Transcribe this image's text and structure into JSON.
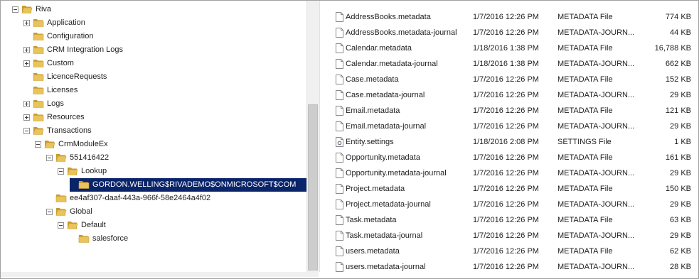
{
  "tree": [
    {
      "label": "Riva",
      "expander": "minus",
      "depth": 0,
      "open": true
    },
    {
      "label": "Application",
      "expander": "plus",
      "depth": 1
    },
    {
      "label": "Configuration",
      "expander": "none",
      "depth": 1
    },
    {
      "label": "CRM Integration Logs",
      "expander": "plus",
      "depth": 1
    },
    {
      "label": "Custom",
      "expander": "plus",
      "depth": 1
    },
    {
      "label": "LicenceRequests",
      "expander": "none",
      "depth": 1
    },
    {
      "label": "Licenses",
      "expander": "none",
      "depth": 1
    },
    {
      "label": "Logs",
      "expander": "plus",
      "depth": 1
    },
    {
      "label": "Resources",
      "expander": "plus",
      "depth": 1
    },
    {
      "label": "Transactions",
      "expander": "minus",
      "depth": 1,
      "open": true
    },
    {
      "label": "CrmModuleEx",
      "expander": "minus",
      "depth": 2,
      "open": true
    },
    {
      "label": "551416422",
      "expander": "minus",
      "depth": 3,
      "open": true
    },
    {
      "label": "Lookup",
      "expander": "minus",
      "depth": 4,
      "open": true
    },
    {
      "label": "GORDON.WELLING$RIVADEMO$ONMICROSOFT$COM",
      "expander": "none",
      "depth": 5,
      "selected": true
    },
    {
      "label": "ee4af307-daaf-443a-966f-58e2464a4f02",
      "expander": "none",
      "depth": 3
    },
    {
      "label": "Global",
      "expander": "minus",
      "depth": 3,
      "open": true
    },
    {
      "label": "Default",
      "expander": "minus",
      "depth": 4,
      "open": true
    },
    {
      "label": "salesforce",
      "expander": "none",
      "depth": 5
    }
  ],
  "files": [
    {
      "name": "AddressBooks.metadata",
      "date": "1/7/2016 12:26 PM",
      "type": "METADATA File",
      "size": "774 KB",
      "icon": "file-icon"
    },
    {
      "name": "AddressBooks.metadata-journal",
      "date": "1/7/2016 12:26 PM",
      "type": "METADATA-JOURN...",
      "size": "44 KB",
      "icon": "file-icon"
    },
    {
      "name": "Calendar.metadata",
      "date": "1/18/2016 1:38 PM",
      "type": "METADATA File",
      "size": "16,788 KB",
      "icon": "file-icon"
    },
    {
      "name": "Calendar.metadata-journal",
      "date": "1/18/2016 1:38 PM",
      "type": "METADATA-JOURN...",
      "size": "662 KB",
      "icon": "file-icon"
    },
    {
      "name": "Case.metadata",
      "date": "1/7/2016 12:26 PM",
      "type": "METADATA File",
      "size": "152 KB",
      "icon": "file-icon"
    },
    {
      "name": "Case.metadata-journal",
      "date": "1/7/2016 12:26 PM",
      "type": "METADATA-JOURN...",
      "size": "29 KB",
      "icon": "file-icon"
    },
    {
      "name": "Email.metadata",
      "date": "1/7/2016 12:26 PM",
      "type": "METADATA File",
      "size": "121 KB",
      "icon": "file-icon"
    },
    {
      "name": "Email.metadata-journal",
      "date": "1/7/2016 12:26 PM",
      "type": "METADATA-JOURN...",
      "size": "29 KB",
      "icon": "file-icon"
    },
    {
      "name": "Entity.settings",
      "date": "1/18/2016 2:08 PM",
      "type": "SETTINGS File",
      "size": "1 KB",
      "icon": "settings-file-icon"
    },
    {
      "name": "Opportunity.metadata",
      "date": "1/7/2016 12:26 PM",
      "type": "METADATA File",
      "size": "161 KB",
      "icon": "file-icon"
    },
    {
      "name": "Opportunity.metadata-journal",
      "date": "1/7/2016 12:26 PM",
      "type": "METADATA-JOURN...",
      "size": "29 KB",
      "icon": "file-icon"
    },
    {
      "name": "Project.metadata",
      "date": "1/7/2016 12:26 PM",
      "type": "METADATA File",
      "size": "150 KB",
      "icon": "file-icon"
    },
    {
      "name": "Project.metadata-journal",
      "date": "1/7/2016 12:26 PM",
      "type": "METADATA-JOURN...",
      "size": "29 KB",
      "icon": "file-icon"
    },
    {
      "name": "Task.metadata",
      "date": "1/7/2016 12:26 PM",
      "type": "METADATA File",
      "size": "63 KB",
      "icon": "file-icon"
    },
    {
      "name": "Task.metadata-journal",
      "date": "1/7/2016 12:26 PM",
      "type": "METADATA-JOURN...",
      "size": "29 KB",
      "icon": "file-icon"
    },
    {
      "name": "users.metadata",
      "date": "1/7/2016 12:26 PM",
      "type": "METADATA File",
      "size": "62 KB",
      "icon": "file-icon"
    },
    {
      "name": "users.metadata-journal",
      "date": "1/7/2016 12:26 PM",
      "type": "METADATA-JOURN...",
      "size": "28 KB",
      "icon": "file-icon"
    }
  ],
  "colors": {
    "selection": "#0a246a",
    "folder": "#e8c45a",
    "folder_dark": "#c99a2e"
  }
}
